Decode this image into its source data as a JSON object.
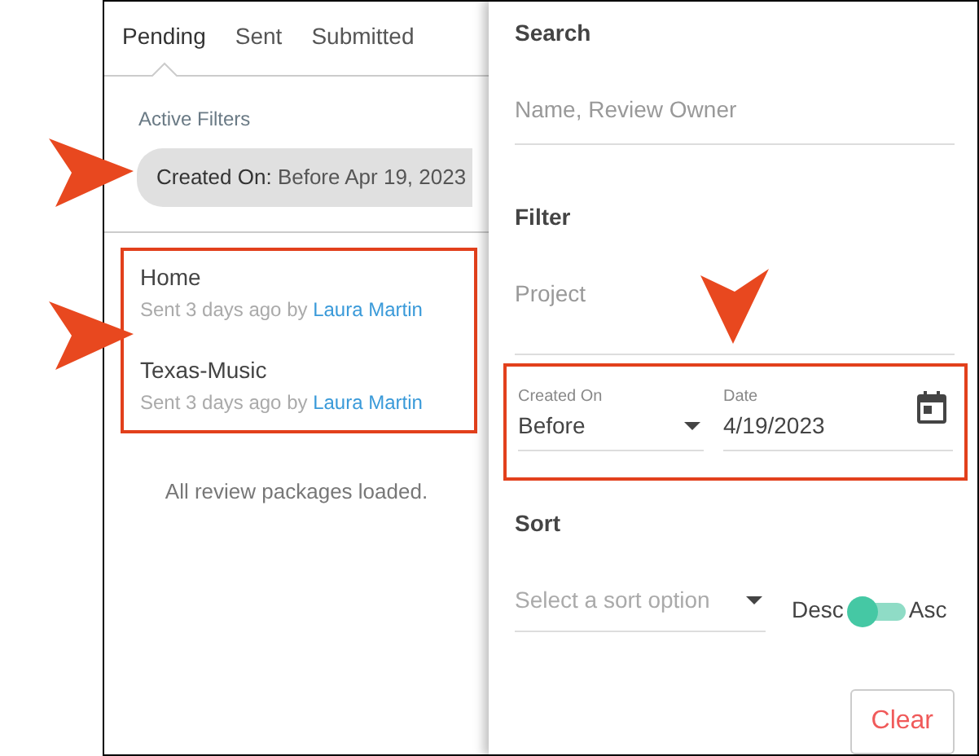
{
  "tabs": [
    {
      "label": "Pending",
      "selected": true
    },
    {
      "label": "Sent",
      "selected": false
    },
    {
      "label": "Submitted",
      "selected": false
    }
  ],
  "active_filters": {
    "heading": "Active Filters",
    "chips": [
      {
        "label": "Created On:",
        "value": "Before Apr 19, 2023"
      }
    ]
  },
  "packages": {
    "highlighted": true,
    "items": [
      {
        "name": "Home",
        "sent": "Sent 3 days ago by",
        "owner": "Laura Martin"
      },
      {
        "name": "Texas-Music",
        "sent": "Sent 3 days ago by",
        "owner": "Laura Martin"
      }
    ]
  },
  "status": "All review packages loaded.",
  "panel": {
    "search": {
      "heading": "Search",
      "placeholder": "Name, Review Owner"
    },
    "filter": {
      "heading": "Filter",
      "project_placeholder": "Project",
      "highlighted": true,
      "created_on": {
        "label": "Created On",
        "value": "Before"
      },
      "date": {
        "label": "Date",
        "value": "4/19/2023"
      }
    },
    "sort": {
      "heading": "Sort",
      "placeholder": "Select a sort option",
      "desc_label": "Desc",
      "asc_label": "Asc",
      "ascending": false
    },
    "clear_button": "Clear"
  },
  "callouts": [
    {
      "kind": "right"
    },
    {
      "kind": "right"
    },
    {
      "kind": "down"
    }
  ]
}
